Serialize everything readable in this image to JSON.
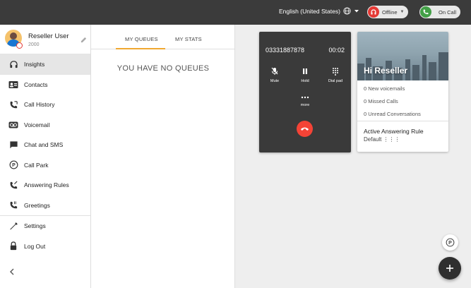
{
  "topbar": {
    "language": "English (United States)",
    "status_offline": "Offline",
    "status_oncall": "On Call"
  },
  "user": {
    "name": "Reseller User",
    "extension": "2000"
  },
  "nav": {
    "items": [
      {
        "label": "Insights",
        "icon": "headset-icon",
        "active": true
      },
      {
        "label": "Contacts",
        "icon": "contact-card-icon"
      },
      {
        "label": "Call History",
        "icon": "call-history-icon"
      },
      {
        "label": "Voicemail",
        "icon": "voicemail-icon"
      },
      {
        "label": "Chat and SMS",
        "icon": "chat-icon"
      },
      {
        "label": "Call Park",
        "icon": "park-icon"
      },
      {
        "label": "Answering Rules",
        "icon": "answering-rules-icon"
      },
      {
        "label": "Greetings",
        "icon": "greetings-icon"
      }
    ],
    "settings": "Settings",
    "logout": "Log Out"
  },
  "queues": {
    "tab_queues": "MY QUEUES",
    "tab_stats": "MY STATS",
    "empty": "YOU HAVE NO QUEUES"
  },
  "call": {
    "number": "03331887878",
    "timer": "00:02",
    "mute": "Mute",
    "hold": "Hold",
    "dialpad": "Dial pad",
    "more": "more"
  },
  "info": {
    "greeting": "Hi Reseller",
    "voicemails": "0 New voicemails",
    "missed": "0 Missed Calls",
    "unread": "0 Unread Conversations",
    "rule_title": "Active Answering Rule",
    "rule_value": "Default ⋮⋮⋮"
  },
  "colors": {
    "topbar": "#3b3b3b",
    "accent_tab": "#f0a830",
    "hangup": "#f44336",
    "offline": "#e53935",
    "oncall": "#43a047"
  }
}
